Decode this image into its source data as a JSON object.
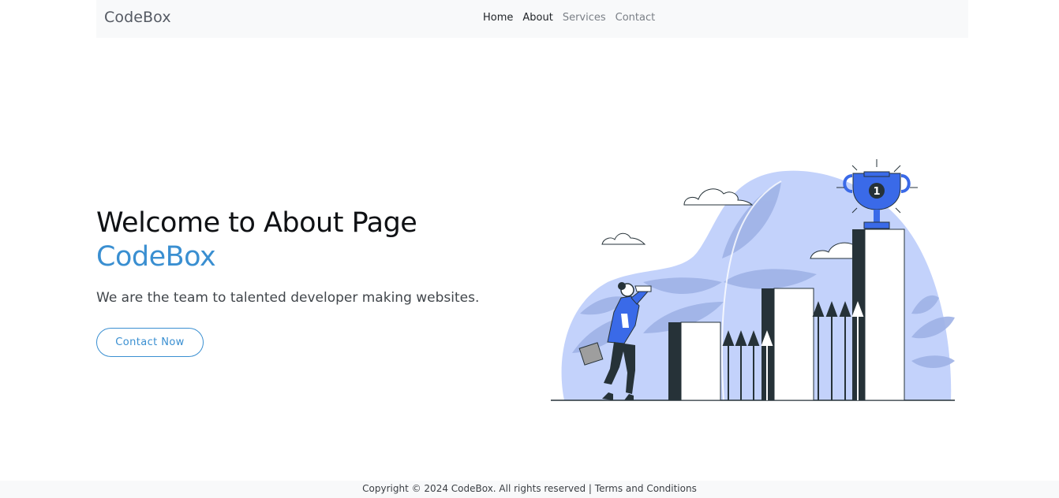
{
  "navbar": {
    "brand": "CodeBox",
    "links": [
      "Home",
      "About",
      "Services",
      "Contact"
    ]
  },
  "hero": {
    "title": "Welcome to About Page",
    "brand": "CodeBox",
    "subtitle": "We are the team to talented developer making websites.",
    "button_label": "Contact Now"
  },
  "illustration": {
    "trophy_number": "1",
    "colors": {
      "accent": "#3a8fd1",
      "blob": "#c3d2fb",
      "dark": "#263238",
      "jacket": "#3a6ae8"
    }
  },
  "footer": {
    "copyright": "Copyright © 2024 CodeBox. All rights reserved",
    "separator": " | ",
    "terms": "Terms and Conditions"
  }
}
